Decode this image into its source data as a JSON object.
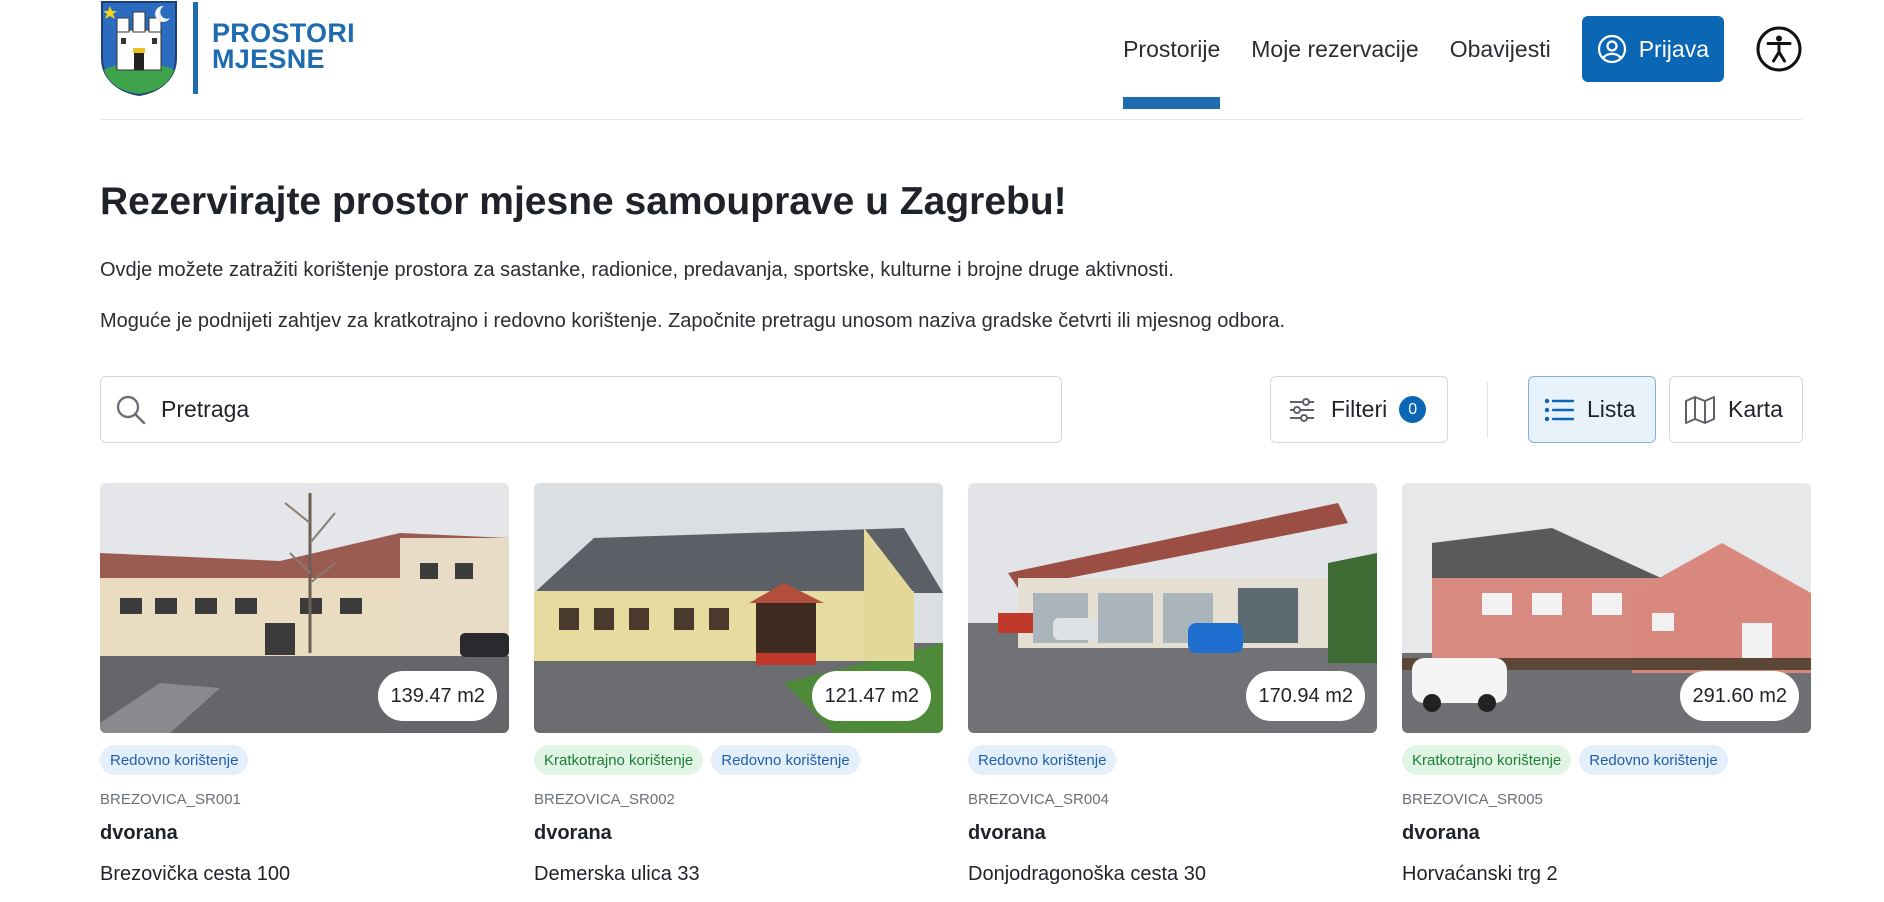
{
  "header": {
    "logo_line1": "PROSTORI",
    "logo_line2": "MJESNE",
    "nav": [
      {
        "label": "Prostorije",
        "active": true
      },
      {
        "label": "Moje rezervacije",
        "active": false
      },
      {
        "label": "Obavijesti",
        "active": false
      }
    ],
    "login_label": "Prijava",
    "accent_color": "#0b66b3"
  },
  "intro": {
    "title": "Rezervirajte prostor mjesne samouprave u Zagrebu!",
    "line1": "Ovdje možete zatražiti korištenje prostora za sastanke, radionice, predavanja, sportske, kulturne i brojne druge aktivnosti.",
    "line2": "Moguće je podnijeti zahtjev za kratkotrajno i redovno korištenje. Započnite pretragu unosom naziva gradske četvrti ili mjesnog odbora."
  },
  "toolbar": {
    "search_placeholder": "Pretraga",
    "filter_label": "Filteri",
    "filter_count": "0",
    "view_list_label": "Lista",
    "view_map_label": "Karta",
    "active_view": "Lista"
  },
  "cards": [
    {
      "area": "139.47 m2",
      "tags": [
        {
          "label": "Redovno korištenje",
          "kind": "blue"
        }
      ],
      "code": "BREZOVICA_SR001",
      "type": "dvorana",
      "address": "Brezovička cesta 100"
    },
    {
      "area": "121.47 m2",
      "tags": [
        {
          "label": "Kratkotrajno korištenje",
          "kind": "green"
        },
        {
          "label": "Redovno korištenje",
          "kind": "blue"
        }
      ],
      "code": "BREZOVICA_SR002",
      "type": "dvorana",
      "address": "Demerska ulica 33"
    },
    {
      "area": "170.94 m2",
      "tags": [
        {
          "label": "Redovno korištenje",
          "kind": "blue"
        }
      ],
      "code": "BREZOVICA_SR004",
      "type": "dvorana",
      "address": "Donjodragonoška cesta 30"
    },
    {
      "area": "291.60 m2",
      "tags": [
        {
          "label": "Kratkotrajno korištenje",
          "kind": "green"
        },
        {
          "label": "Redovno korištenje",
          "kind": "blue"
        }
      ],
      "code": "BREZOVICA_SR005",
      "type": "dvorana",
      "address": "Horvaćanski trg 2"
    }
  ]
}
